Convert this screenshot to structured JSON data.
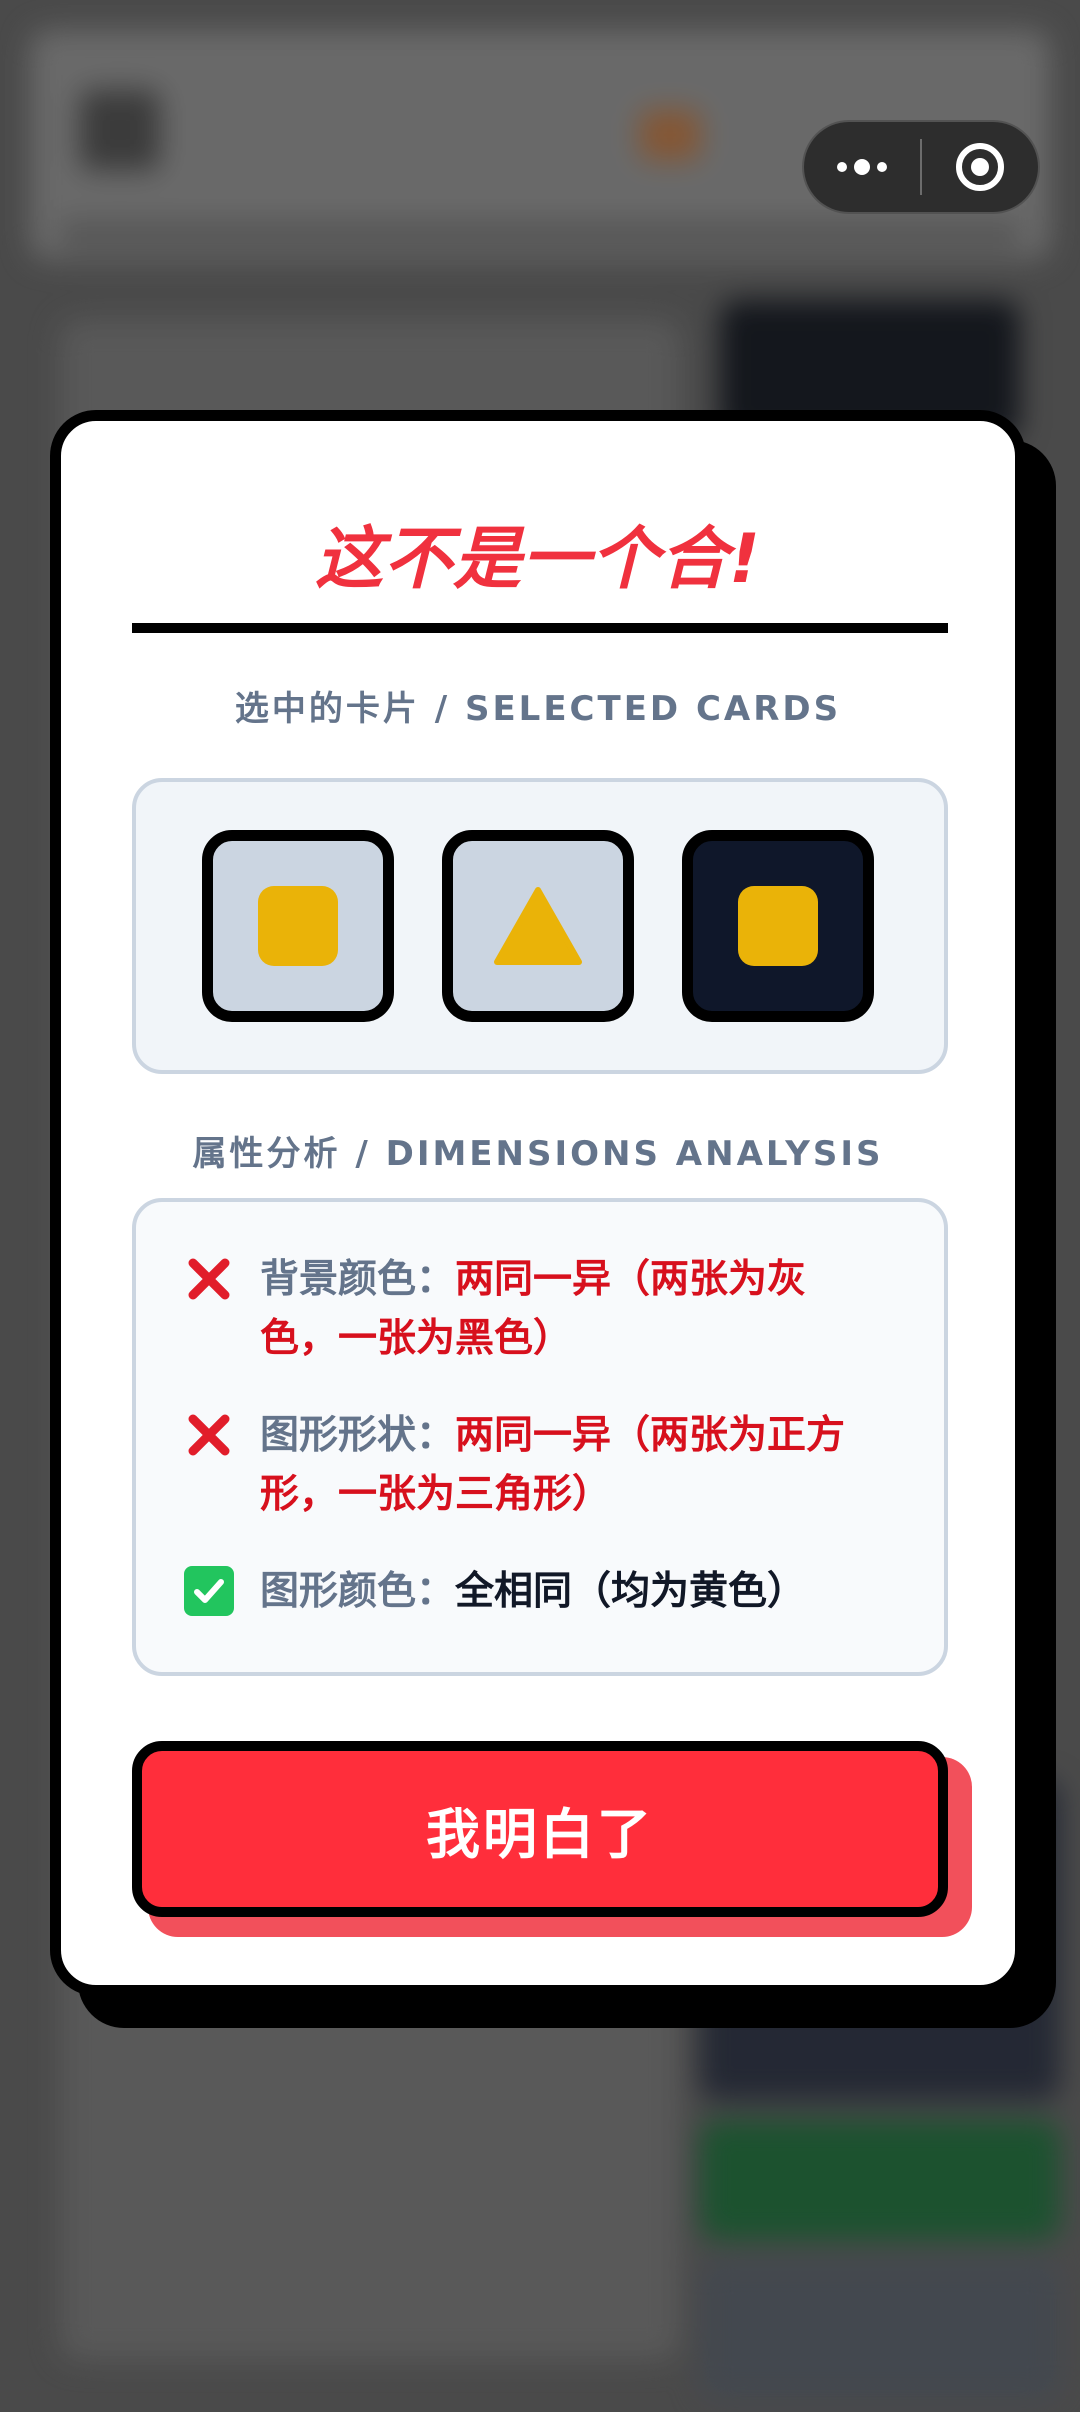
{
  "capsule": {
    "more_icon": "more-dots-icon",
    "close_icon": "target-close-icon"
  },
  "modal": {
    "title": "这不是一个合!",
    "selected_label": "选中的卡片 / SELECTED CARDS",
    "cards": [
      {
        "background": "gray",
        "shape": "square",
        "shape_color": "#eab308"
      },
      {
        "background": "gray",
        "shape": "triangle",
        "shape_color": "#eab308"
      },
      {
        "background": "black",
        "shape": "square",
        "shape_color": "#eab308"
      }
    ],
    "analysis_label": "属性分析 / DIMENSIONS ANALYSIS",
    "rows": [
      {
        "status": "fail",
        "icon": "cross-icon",
        "line1_key": "背景颜色：",
        "line1_val": "两同一异（两张为灰",
        "line2": "色，一张为黑色）"
      },
      {
        "status": "fail",
        "icon": "cross-icon",
        "line1_key": "图形形状：",
        "line1_val": "两同一异（两张为正方",
        "line2": "形，一张为三角形）"
      },
      {
        "status": "pass",
        "icon": "check-icon",
        "line1_key": "图形颜色：",
        "line1_val": "全相同（均为黄色）"
      }
    ],
    "confirm_button": "我明白了"
  },
  "colors": {
    "accent_red": "#ff2e3b",
    "title_red": "#f0313e",
    "fail_red": "#d7101d",
    "shape_yellow": "#eab308",
    "slate": "#64748b"
  }
}
